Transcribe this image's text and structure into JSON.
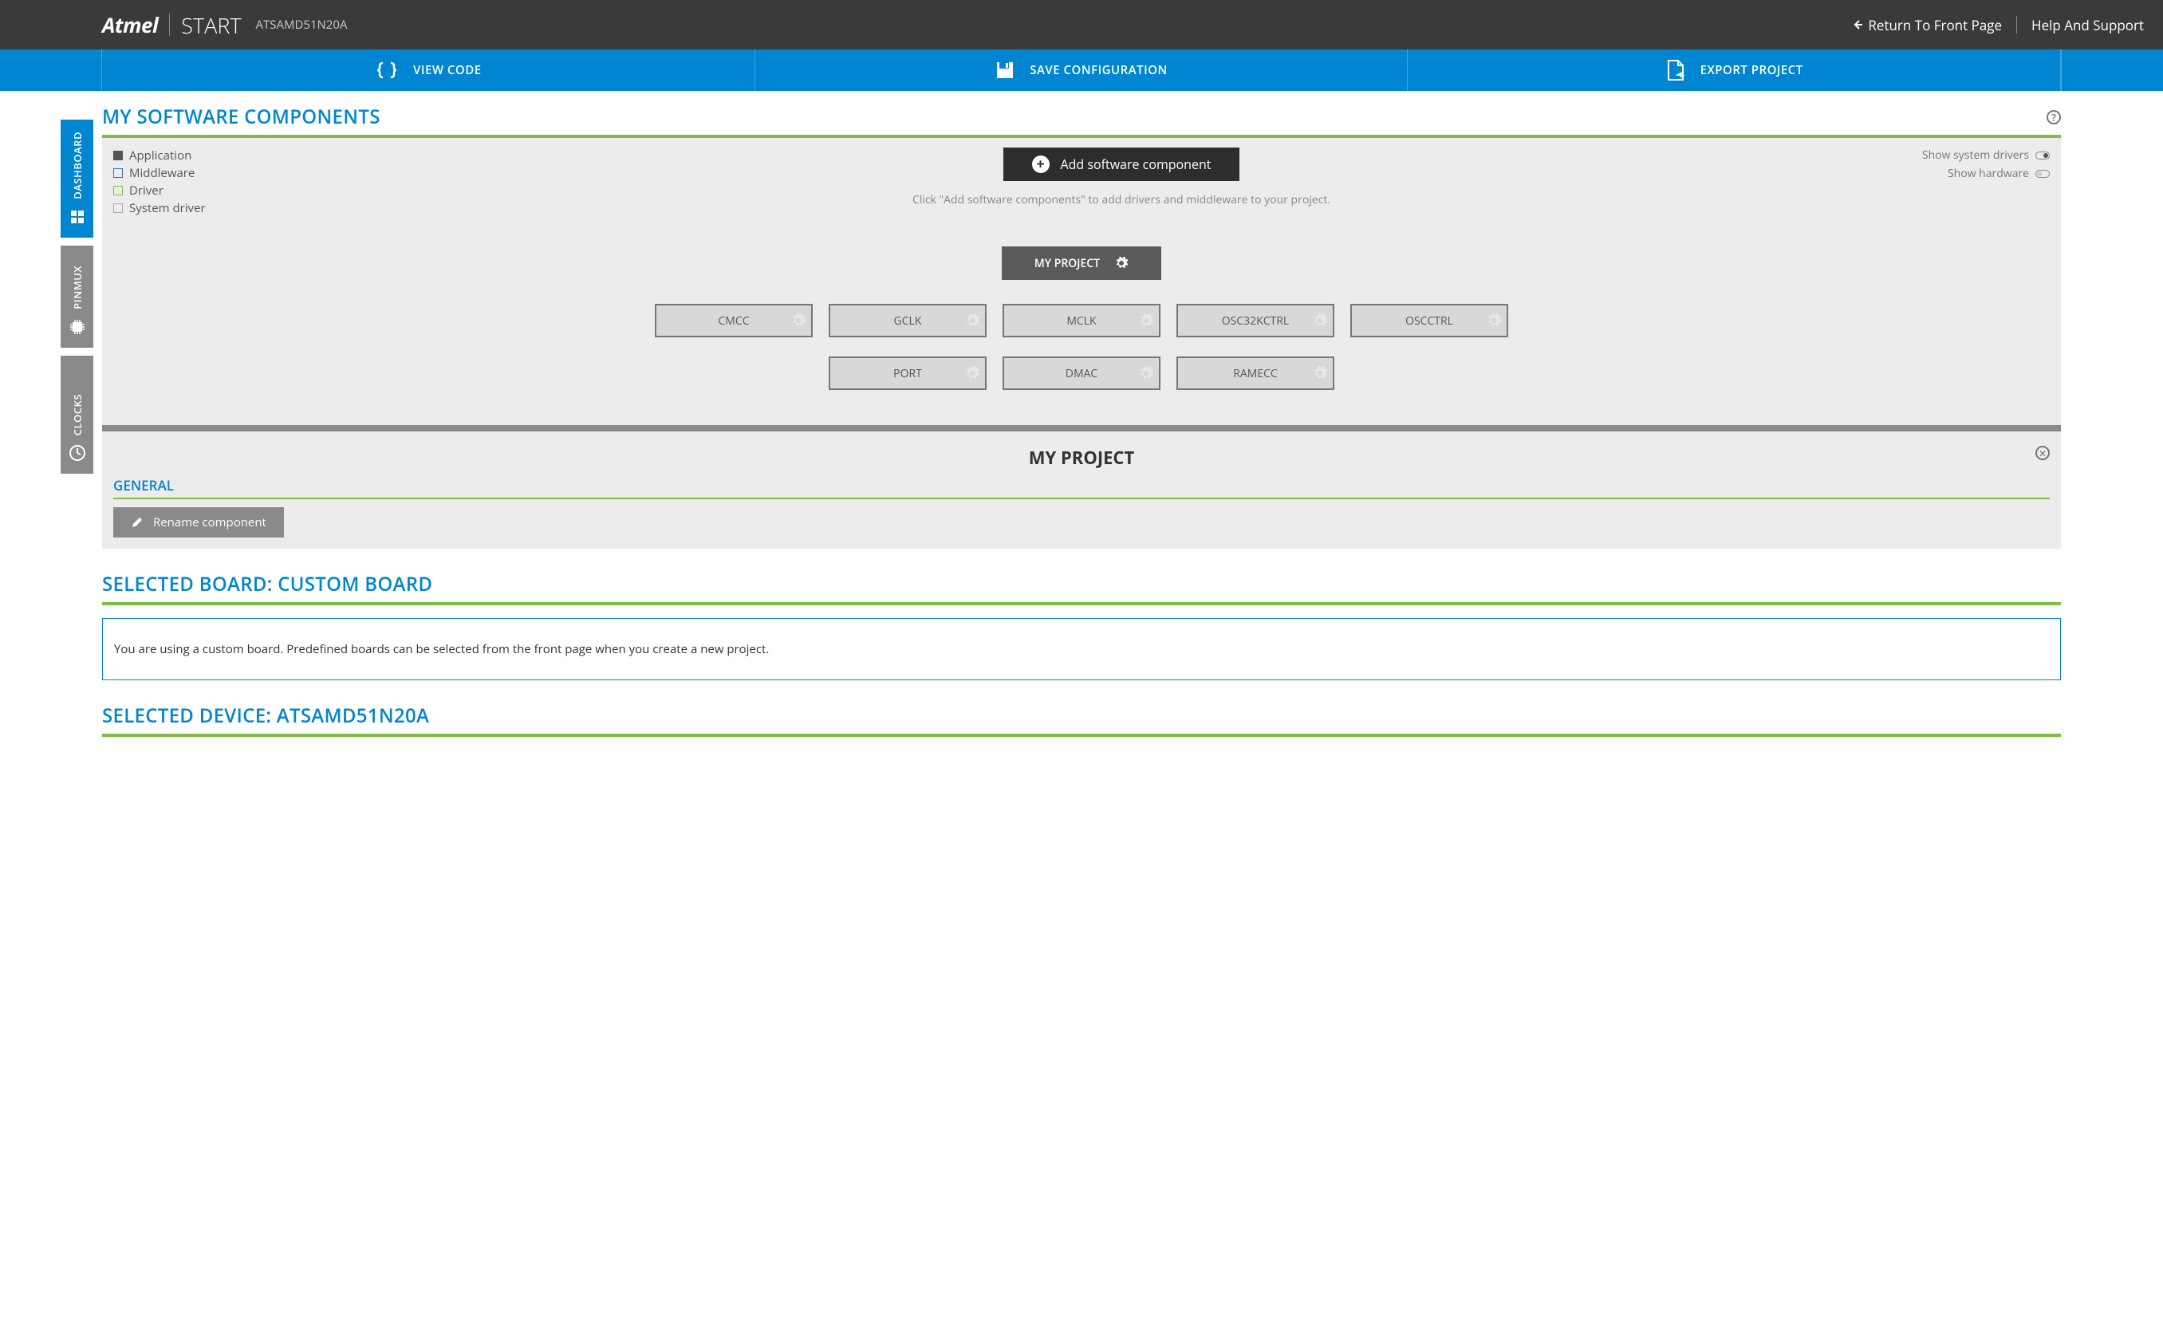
{
  "header": {
    "brand": "Atmel",
    "start": "START",
    "device": "ATSAMD51N20A",
    "return_link": "Return To Front Page",
    "help_link": "Help And Support"
  },
  "actions": {
    "view_code": "VIEW CODE",
    "save_config": "SAVE CONFIGURATION",
    "export_project": "EXPORT PROJECT"
  },
  "sidetabs": {
    "dashboard": "DASHBOARD",
    "pinmux": "PINMUX",
    "clocks": "CLOCKS"
  },
  "components": {
    "title": "MY SOFTWARE COMPONENTS",
    "legend": {
      "application": "Application",
      "middleware": "Middleware",
      "driver": "Driver",
      "system_driver": "System driver"
    },
    "add_button": "Add software component",
    "hint": "Click \"Add software components\" to add drivers and middleware to your project.",
    "toggles": {
      "show_system_drivers": "Show system drivers",
      "show_hardware": "Show hardware"
    },
    "project_card": "MY PROJECT",
    "nodes_row1": [
      "CMCC",
      "GCLK",
      "MCLK",
      "OSC32KCTRL",
      "OSCCTRL"
    ],
    "nodes_row2": [
      "PORT",
      "DMAC",
      "RAMECC"
    ]
  },
  "detail": {
    "title": "MY PROJECT",
    "general_label": "GENERAL",
    "rename_label": "Rename component"
  },
  "board": {
    "title": "SELECTED BOARD: CUSTOM BOARD",
    "info": "You are using a custom board. Predefined boards can be selected from the front page when you create a new project."
  },
  "device_section": {
    "title": "SELECTED DEVICE: ATSAMD51N20A"
  }
}
